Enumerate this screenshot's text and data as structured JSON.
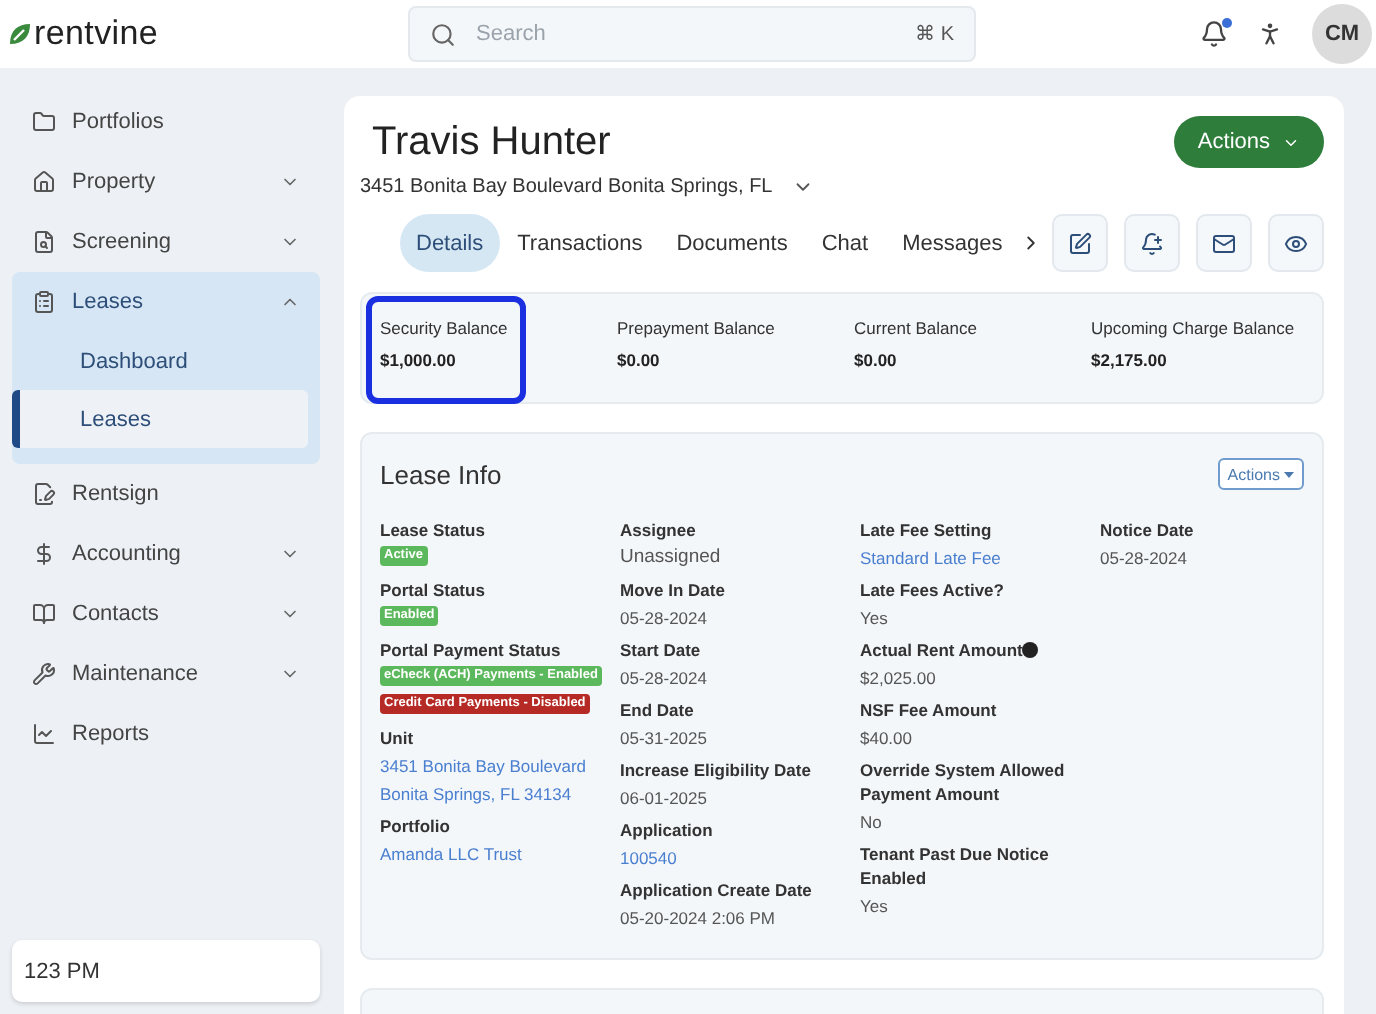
{
  "topbar": {
    "logo": "rentvine",
    "search": {
      "placeholder": "Search",
      "shortcut": "⌘ K"
    },
    "notifications": {
      "unread": true
    },
    "avatar": "CM"
  },
  "sidebar": {
    "items": [
      {
        "label": "Portfolios",
        "selected": false
      },
      {
        "label": "Property",
        "selected": false,
        "expanded": false
      },
      {
        "label": "Screening",
        "selected": false,
        "expanded": false
      },
      {
        "label": "Leases",
        "selected": true,
        "expanded": true,
        "children": [
          {
            "label": "Dashboard",
            "selected": false
          },
          {
            "label": "Leases",
            "selected": true
          }
        ]
      },
      {
        "label": "Rentsign",
        "selected": false
      },
      {
        "label": "Accounting",
        "selected": false,
        "expanded": false
      },
      {
        "label": "Contacts",
        "selected": false,
        "expanded": false
      },
      {
        "label": "Maintenance",
        "selected": false,
        "expanded": false
      },
      {
        "label": "Reports",
        "selected": false
      }
    ],
    "footer": "123 PM"
  },
  "header": {
    "name": "Travis Hunter",
    "address": "3451 Bonita Bay Boulevard Bonita Springs, FL",
    "actions": "Actions"
  },
  "tabs": [
    {
      "label": "Details",
      "selected": true
    },
    {
      "label": "Transactions",
      "selected": false
    },
    {
      "label": "Documents",
      "selected": false
    },
    {
      "label": "Chat",
      "selected": false
    },
    {
      "label": "Messages",
      "selected": false
    }
  ],
  "balances": [
    {
      "label": "Security Balance",
      "value": "$1,000.00",
      "highlighted": true
    },
    {
      "label": "Prepayment Balance",
      "value": "$0.00",
      "highlighted": false
    },
    {
      "label": "Current Balance",
      "value": "$0.00",
      "highlighted": false
    },
    {
      "label": "Upcoming Charge Balance",
      "value": "$2,175.00",
      "highlighted": false
    }
  ],
  "lease_info": {
    "title": "Lease Info",
    "actions": "Actions",
    "columns": [
      [
        {
          "label": "Lease Status",
          "kind": "badges",
          "badges": [
            {
              "text": "Active",
              "color": "#5cb85c"
            }
          ]
        },
        {
          "label": "Portal Status",
          "kind": "badges",
          "badges": [
            {
              "text": "Enabled",
              "color": "#5cb85c"
            }
          ]
        },
        {
          "label": "Portal Payment Status",
          "kind": "badges",
          "badges": [
            {
              "text": "eCheck (ACH) Payments - Enabled",
              "color": "#5cb85c"
            },
            {
              "text": "Credit Card Payments - Disabled",
              "color": "#b52a25"
            }
          ]
        },
        {
          "label": "Unit",
          "kind": "link",
          "lines": [
            "3451 Bonita Bay Boulevard",
            "Bonita Springs, FL 34134"
          ]
        },
        {
          "label": "Portfolio",
          "kind": "link",
          "lines": [
            "Amanda LLC Trust"
          ]
        }
      ],
      [
        {
          "label": "Assignee",
          "kind": "large",
          "lines": [
            "Unassigned"
          ]
        },
        {
          "label": "Move In Date",
          "kind": "text",
          "lines": [
            "05-28-2024"
          ]
        },
        {
          "label": "Start Date",
          "kind": "text",
          "lines": [
            "05-28-2024"
          ]
        },
        {
          "label": "End Date",
          "kind": "text",
          "lines": [
            "05-31-2025"
          ]
        },
        {
          "label": "Increase Eligibility Date",
          "kind": "text",
          "lines": [
            "06-01-2025"
          ]
        },
        {
          "label": "Application",
          "kind": "link",
          "lines": [
            "100540"
          ]
        },
        {
          "label": "Application Create Date",
          "kind": "text",
          "lines": [
            "05-20-2024 2:06 PM"
          ]
        }
      ],
      [
        {
          "label": "Late Fee Setting",
          "kind": "link",
          "lines": [
            "Standard Late Fee"
          ]
        },
        {
          "label": "Late Fees Active?",
          "kind": "text",
          "lines": [
            "Yes"
          ]
        },
        {
          "label": "Actual Rent Amount",
          "kind": "text",
          "info": true,
          "lines": [
            "$2,025.00"
          ]
        },
        {
          "label": "NSF Fee Amount",
          "kind": "text",
          "lines": [
            "$40.00"
          ]
        },
        {
          "label": "Override System Allowed Payment Amount",
          "kind": "text",
          "lines": [
            "No"
          ]
        },
        {
          "label": "Tenant Past Due Notice Enabled",
          "kind": "text",
          "lines": [
            "Yes"
          ]
        }
      ],
      [
        {
          "label": "Notice Date",
          "kind": "text",
          "lines": [
            "05-28-2024"
          ]
        }
      ]
    ]
  }
}
